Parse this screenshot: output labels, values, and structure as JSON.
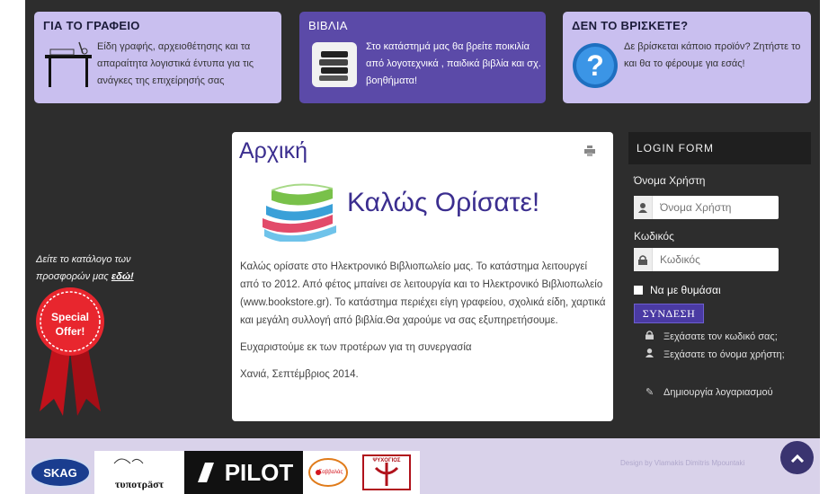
{
  "features": [
    {
      "title": "ΓΙΑ ΤΟ ΓΡΑΦΕΙΟ",
      "text": "Είδη γραφής, αρχειοθέτησης και τα απαραίτητα λογιστικά έντυπα για τις ανάγκες της επιχείρησής σας",
      "icon": "desk-icon"
    },
    {
      "title": "ΒΙΒΛΙΑ",
      "text": "Στο κατάστημά μας θα βρείτε ποικιλία από λογοτεχνικά , παιδικά βιβλία και σχ. βοηθήματα!",
      "icon": "books-stack-icon"
    },
    {
      "title": "ΔΕΝ ΤΟ ΒΡΙΣΚΕΤΕ?",
      "text": "Δε βρίσκεται κάποιο προϊόν? Ζητήστε το και θα το φέρουμε για εσάς!",
      "icon": "question-icon"
    }
  ],
  "promo": {
    "text": "Δείτε το κατάλογο των προσφορών μας",
    "link": "εδώ!",
    "badge_line1": "Special",
    "badge_line2": "Offer!"
  },
  "article": {
    "title": "Αρχική",
    "welcome": "Καλώς Ορίσατε!",
    "paragraphs": [
      "Καλώς ορίσατε στο Ηλεκτρονικό Βιβλιοπωλείο μας. Το κατάστημα λειτουργεί από το 2012. Από φέτος μπαίνει σε λειτουργία και το Ηλεκτρονικό Βιβλιοπωλείο (www.bookstore.gr). Το κατάστημα περιέχει είγη γραφείου, σχολικά είδη, χαρτικά και μεγάλη συλλογή από βιβλία.Θα χαρούμε να σας εξυπηρετήσουμε.",
      "Ευχαριστούμε εκ των προτέρων για τη συνεργασία",
      "Χανιά, Σεπτέμβριος 2014."
    ]
  },
  "login": {
    "heading": "LOGIN FORM",
    "username_label": "Όνομα Χρήστη",
    "username_placeholder": "Όνομα Χρήστη",
    "password_label": "Κωδικός",
    "password_placeholder": "Κωδικός",
    "remember": "Να με θυμάσαι",
    "submit": "ΣΥΝΔΕΣΗ",
    "forgot_password": "Ξεχάσατε τον κωδικό σας;",
    "forgot_username": "Ξεχάσατε το όνομα χρήστη;",
    "register": "Δημιουργία λογαριασμού"
  },
  "footer": {
    "credit": "Design by Vlamakis Dimitris Mpountaki",
    "logos": [
      "SKAG",
      "τυποτρäστ",
      "PILOT",
      "Σαββαλάς",
      "ΨΥΧΟΓΙΟΣ"
    ]
  },
  "colors": {
    "accent": "#3b2e8f",
    "panel": "#2d2d2d",
    "feature_light": "#c9bfef",
    "feature_dark": "#5b4aa8"
  }
}
